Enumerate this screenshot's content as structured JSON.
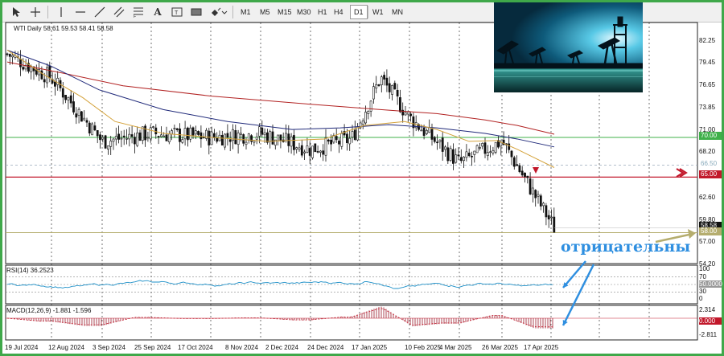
{
  "toolbar": {
    "tools": [
      "cursor-icon",
      "crosshair-icon",
      "vertical-line-icon",
      "horizontal-line-icon",
      "trend-line-icon",
      "channel-icon",
      "fibonacci-icon",
      "text-icon",
      "text-label-icon",
      "rectangle-icon",
      "shapes-icon"
    ],
    "timeframes": [
      "M1",
      "M5",
      "M15",
      "M30",
      "H1",
      "H4",
      "D1",
      "W1",
      "MN"
    ],
    "active_timeframe": "D1"
  },
  "chart": {
    "symbol_line": "WTI Daily  58.61 59.53 58.41 58.58",
    "price_ticks": [
      "82.25",
      "79.45",
      "76.65",
      "73.85",
      "71.00",
      "68.20",
      "65.40",
      "62.60",
      "59.80",
      "57.00",
      "54.20"
    ],
    "price_boxes": {
      "green": "70.00",
      "light": "66.50",
      "red": "65.00",
      "current": "58.58",
      "olive": "58.00"
    },
    "date_ticks": [
      "19 Jul 2024",
      "12 Aug 2024",
      "3 Sep 2024",
      "25 Sep 2024",
      "17 Oct 2024",
      "8 Nov 2024",
      "2 Dec 2024",
      "24 Dec 2024",
      "17 Jan 2025",
      "10 Feb 2025",
      "4 Mar 2025",
      "26 Mar 2025",
      "17 Apr 2025"
    ],
    "annotation": "отрицательны",
    "colors": {
      "frame": "#3fa84a",
      "annotation": "#2f8fe0",
      "ma_fast": "#d4a23a",
      "ma_mid": "#202a7a",
      "ma_slow": "#b22222",
      "level_green": "#3fb04a",
      "level_red": "#c2182b",
      "level_olive": "#b5ad6e",
      "rsi": "#1e90c8",
      "macd": "#9a1a2a"
    }
  },
  "rsi": {
    "title": "RSI(14) 36.2523",
    "ticks": [
      "100",
      "70",
      "50.0000",
      "30",
      "0"
    ],
    "level": "50.0000"
  },
  "macd": {
    "title": "MACD(12,26,9) -1.881 -1.596",
    "ticks": [
      "2.314",
      "0.000",
      "-2.811"
    ]
  },
  "chart_data": {
    "type": "candlestick",
    "title": "WTI Daily",
    "ohlc_last": {
      "open": 58.61,
      "high": 59.53,
      "low": 58.41,
      "close": 58.58
    },
    "x_range": [
      "19 Jul 2024",
      "25 Apr 2025"
    ],
    "ylim": [
      54.2,
      82.25
    ],
    "horizontal_levels": [
      70.0,
      66.5,
      65.0,
      58.0
    ],
    "series": [
      {
        "name": "Close (approx.)",
        "x": [
          "19 Jul 2024",
          "12 Aug 2024",
          "3 Sep 2024",
          "25 Sep 2024",
          "17 Oct 2024",
          "8 Nov 2024",
          "2 Dec 2024",
          "24 Dec 2024",
          "17 Jan 2025",
          "10 Feb 2025",
          "4 Mar 2025",
          "26 Mar 2025",
          "17 Apr 2025",
          "25 Apr 2025"
        ],
        "values": [
          80.5,
          77.5,
          69.5,
          70.5,
          70.0,
          70.5,
          68.5,
          69.8,
          77.5,
          72.5,
          66.8,
          69.5,
          63.0,
          58.6
        ]
      }
    ]
  }
}
